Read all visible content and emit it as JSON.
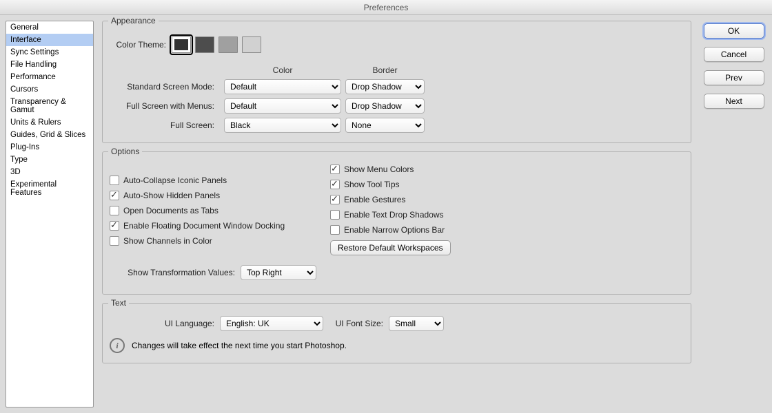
{
  "title": "Preferences",
  "sidebar": {
    "items": [
      {
        "label": "General"
      },
      {
        "label": "Interface"
      },
      {
        "label": "Sync Settings"
      },
      {
        "label": "File Handling"
      },
      {
        "label": "Performance"
      },
      {
        "label": "Cursors"
      },
      {
        "label": "Transparency & Gamut"
      },
      {
        "label": "Units & Rulers"
      },
      {
        "label": "Guides, Grid & Slices"
      },
      {
        "label": "Plug-Ins"
      },
      {
        "label": "Type"
      },
      {
        "label": "3D"
      },
      {
        "label": "Experimental Features"
      }
    ],
    "selected_index": 1
  },
  "buttons": {
    "ok": "OK",
    "cancel": "Cancel",
    "prev": "Prev",
    "next": "Next"
  },
  "appearance": {
    "legend": "Appearance",
    "color_theme_label": "Color Theme:",
    "swatches": [
      "#323232",
      "#4d4d4d",
      "#a0a0a0",
      "#d1d1d1"
    ],
    "selected_swatch": 0,
    "col_color": "Color",
    "col_border": "Border",
    "rows": [
      {
        "label": "Standard Screen Mode:",
        "color": "Default",
        "border": "Drop Shadow"
      },
      {
        "label": "Full Screen with Menus:",
        "color": "Default",
        "border": "Drop Shadow"
      },
      {
        "label": "Full Screen:",
        "color": "Black",
        "border": "None"
      }
    ]
  },
  "options": {
    "legend": "Options",
    "left": [
      {
        "label": "Auto-Collapse Iconic Panels",
        "checked": false
      },
      {
        "label": "Auto-Show Hidden Panels",
        "checked": true
      },
      {
        "label": "Open Documents as Tabs",
        "checked": false
      },
      {
        "label": "Enable Floating Document Window Docking",
        "checked": true
      },
      {
        "label": "Show Channels in Color",
        "checked": false
      }
    ],
    "right": [
      {
        "label": "Show Menu Colors",
        "checked": true
      },
      {
        "label": "Show Tool Tips",
        "checked": true
      },
      {
        "label": "Enable Gestures",
        "checked": true
      },
      {
        "label": "Enable Text Drop Shadows",
        "checked": false
      },
      {
        "label": "Enable Narrow Options Bar",
        "checked": false
      }
    ],
    "restore_label": "Restore Default Workspaces",
    "show_transform_label": "Show Transformation Values:",
    "show_transform_value": "Top Right"
  },
  "text_section": {
    "legend": "Text",
    "ui_language_label": "UI Language:",
    "ui_language_value": "English: UK",
    "ui_font_size_label": "UI Font Size:",
    "ui_font_size_value": "Small",
    "info": "Changes will take effect the next time you start Photoshop."
  }
}
